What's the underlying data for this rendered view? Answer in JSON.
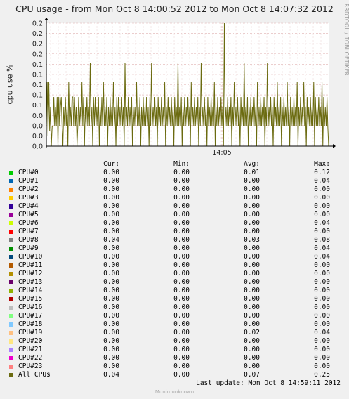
{
  "title": "CPU usage - from Mon Oct  8 14:00:52 2012 to Mon Oct  8 14:07:32 2012",
  "watermark": "RRDTOOL / TOBI OETIKER",
  "footer": "Munin unknown",
  "last_update": "Last update:  Mon Oct  8 14:59:11 2012",
  "colors": {
    "background": "#f0f0f0",
    "plot_bg": "#ffffff",
    "grid": "#e0b0b0",
    "all_cpus": "#6b6b10",
    "axis": "#000000"
  },
  "legend_headers": {
    "cur": "Cur:",
    "min": "Min:",
    "avg": "Avg:",
    "max": "Max:"
  },
  "legend": [
    {
      "name": "CPU#0",
      "color": "#00cc00",
      "cur": "0.00",
      "min": "0.00",
      "avg": "0.01",
      "max": "0.12"
    },
    {
      "name": "CPU#1",
      "color": "#0066b3",
      "cur": "0.00",
      "min": "0.00",
      "avg": "0.00",
      "max": "0.04"
    },
    {
      "name": "CPU#2",
      "color": "#ff8000",
      "cur": "0.00",
      "min": "0.00",
      "avg": "0.00",
      "max": "0.00"
    },
    {
      "name": "CPU#3",
      "color": "#ffcc00",
      "cur": "0.00",
      "min": "0.00",
      "avg": "0.00",
      "max": "0.00"
    },
    {
      "name": "CPU#4",
      "color": "#330099",
      "cur": "0.00",
      "min": "0.00",
      "avg": "0.00",
      "max": "0.00"
    },
    {
      "name": "CPU#5",
      "color": "#990099",
      "cur": "0.00",
      "min": "0.00",
      "avg": "0.00",
      "max": "0.00"
    },
    {
      "name": "CPU#6",
      "color": "#ccff00",
      "cur": "0.00",
      "min": "0.00",
      "avg": "0.00",
      "max": "0.04"
    },
    {
      "name": "CPU#7",
      "color": "#ff0000",
      "cur": "0.00",
      "min": "0.00",
      "avg": "0.00",
      "max": "0.00"
    },
    {
      "name": "CPU#8",
      "color": "#808080",
      "cur": "0.04",
      "min": "0.00",
      "avg": "0.03",
      "max": "0.08"
    },
    {
      "name": "CPU#9",
      "color": "#008f00",
      "cur": "0.00",
      "min": "0.00",
      "avg": "0.00",
      "max": "0.04"
    },
    {
      "name": "CPU#10",
      "color": "#00487d",
      "cur": "0.00",
      "min": "0.00",
      "avg": "0.00",
      "max": "0.04"
    },
    {
      "name": "CPU#11",
      "color": "#b35a00",
      "cur": "0.00",
      "min": "0.00",
      "avg": "0.00",
      "max": "0.00"
    },
    {
      "name": "CPU#12",
      "color": "#b38f00",
      "cur": "0.00",
      "min": "0.00",
      "avg": "0.00",
      "max": "0.00"
    },
    {
      "name": "CPU#13",
      "color": "#6b006b",
      "cur": "0.00",
      "min": "0.00",
      "avg": "0.00",
      "max": "0.00"
    },
    {
      "name": "CPU#14",
      "color": "#8fb300",
      "cur": "0.00",
      "min": "0.00",
      "avg": "0.00",
      "max": "0.00"
    },
    {
      "name": "CPU#15",
      "color": "#b30000",
      "cur": "0.00",
      "min": "0.00",
      "avg": "0.00",
      "max": "0.00"
    },
    {
      "name": "CPU#16",
      "color": "#bebebe",
      "cur": "0.00",
      "min": "0.00",
      "avg": "0.00",
      "max": "0.00"
    },
    {
      "name": "CPU#17",
      "color": "#80ff80",
      "cur": "0.00",
      "min": "0.00",
      "avg": "0.00",
      "max": "0.00"
    },
    {
      "name": "CPU#18",
      "color": "#80c9ff",
      "cur": "0.00",
      "min": "0.00",
      "avg": "0.00",
      "max": "0.00"
    },
    {
      "name": "CPU#19",
      "color": "#ffc080",
      "cur": "0.00",
      "min": "0.00",
      "avg": "0.02",
      "max": "0.04"
    },
    {
      "name": "CPU#20",
      "color": "#ffe680",
      "cur": "0.00",
      "min": "0.00",
      "avg": "0.00",
      "max": "0.00"
    },
    {
      "name": "CPU#21",
      "color": "#aa80ff",
      "cur": "0.00",
      "min": "0.00",
      "avg": "0.00",
      "max": "0.00"
    },
    {
      "name": "CPU#22",
      "color": "#ee00cc",
      "cur": "0.00",
      "min": "0.00",
      "avg": "0.00",
      "max": "0.00"
    },
    {
      "name": "CPU#23",
      "color": "#ff8080",
      "cur": "0.00",
      "min": "0.00",
      "avg": "0.00",
      "max": "0.00"
    },
    {
      "name": "All CPUs",
      "color": "#6b6b10",
      "cur": "0.04",
      "min": "0.00",
      "avg": "0.07",
      "max": "0.25"
    }
  ],
  "chart_data": {
    "type": "line",
    "title": "CPU usage - from Mon Oct  8 14:00:52 2012 to Mon Oct  8 14:07:32 2012",
    "ylabel": "cpu use %",
    "xlabel": "",
    "ylim": [
      0,
      0.25
    ],
    "yticks": [
      0.0,
      0.0,
      0.0,
      0.0,
      0.1,
      0.1,
      0.1,
      0.1,
      0.1,
      0.2,
      0.2,
      0.2,
      0.2
    ],
    "xticks": [
      "14:05"
    ],
    "grid": true,
    "series": [
      {
        "name": "All CPUs",
        "color": "#6b6b10",
        "values": [
          0.04,
          0.13,
          0.02,
          0.13,
          0.03,
          0.08,
          0.0,
          0.04,
          0.04,
          0.1,
          0.04,
          0.08,
          0.04,
          0.1,
          0.0,
          0.1,
          0.04,
          0.08,
          0.1,
          0.04,
          0.0,
          0.08,
          0.04,
          0.1,
          0.04,
          0.08,
          0.0,
          0.13,
          0.04,
          0.08,
          0.04,
          0.1,
          0.1,
          0.04,
          0.1,
          0.04,
          0.08,
          0.0,
          0.04,
          0.1,
          0.04,
          0.08,
          0.04,
          0.13,
          0.04,
          0.1,
          0.0,
          0.08,
          0.04,
          0.1,
          0.04,
          0.08,
          0.04,
          0.17,
          0.04,
          0.08,
          0.0,
          0.1,
          0.04,
          0.1,
          0.04,
          0.08,
          0.04,
          0.1,
          0.0,
          0.08,
          0.04,
          0.1,
          0.04,
          0.13,
          0.04,
          0.08,
          0.04,
          0.1,
          0.0,
          0.08,
          0.04,
          0.1,
          0.04,
          0.08,
          0.04,
          0.13,
          0.04,
          0.08,
          0.0,
          0.1,
          0.04,
          0.1,
          0.04,
          0.08,
          0.04,
          0.1,
          0.04,
          0.08,
          0.0,
          0.17,
          0.04,
          0.08,
          0.04,
          0.1,
          0.04,
          0.08,
          0.04,
          0.1,
          0.0,
          0.08,
          0.04,
          0.08,
          0.04,
          0.13,
          0.04,
          0.08,
          0.04,
          0.1,
          0.0,
          0.08,
          0.04,
          0.1,
          0.04,
          0.08,
          0.04,
          0.1,
          0.04,
          0.08,
          0.0,
          0.1,
          0.04,
          0.17,
          0.04,
          0.08,
          0.04,
          0.1,
          0.04,
          0.08,
          0.0,
          0.1,
          0.04,
          0.08,
          0.04,
          0.1,
          0.04,
          0.08,
          0.04,
          0.13,
          0.0,
          0.08,
          0.04,
          0.1,
          0.04,
          0.08,
          0.04,
          0.1,
          0.04,
          0.08,
          0.0,
          0.1,
          0.04,
          0.08,
          0.04,
          0.17,
          0.04,
          0.08,
          0.04,
          0.1,
          0.0,
          0.08,
          0.04,
          0.1,
          0.04,
          0.08,
          0.04,
          0.1,
          0.04,
          0.08,
          0.0,
          0.13,
          0.04,
          0.08,
          0.04,
          0.1,
          0.04,
          0.08,
          0.04,
          0.1,
          0.0,
          0.08,
          0.04,
          0.17,
          0.04,
          0.08,
          0.04,
          0.1,
          0.04,
          0.08,
          0.0,
          0.1,
          0.04,
          0.08,
          0.04,
          0.1,
          0.04,
          0.08,
          0.04,
          0.13,
          0.0,
          0.08,
          0.04,
          0.1,
          0.04,
          0.08,
          0.04,
          0.1,
          0.04,
          0.08,
          0.0,
          0.25,
          0.04,
          0.08,
          0.04,
          0.1,
          0.04,
          0.08,
          0.04,
          0.1,
          0.0,
          0.08,
          0.04,
          0.13,
          0.04,
          0.08,
          0.04,
          0.1,
          0.04,
          0.08,
          0.0,
          0.1,
          0.04,
          0.08,
          0.04,
          0.17,
          0.04,
          0.08,
          0.04,
          0.1,
          0.0,
          0.08,
          0.04,
          0.1,
          0.04,
          0.08,
          0.04,
          0.1,
          0.04,
          0.08,
          0.0,
          0.13,
          0.04,
          0.08,
          0.04,
          0.1,
          0.04,
          0.08,
          0.04,
          0.1,
          0.0,
          0.08,
          0.04,
          0.17,
          0.04,
          0.08,
          0.04,
          0.1,
          0.04,
          0.08,
          0.0,
          0.1,
          0.04,
          0.08,
          0.04,
          0.13,
          0.04,
          0.08,
          0.04,
          0.1,
          0.0,
          0.08,
          0.04,
          0.1,
          0.04,
          0.08,
          0.04,
          0.13,
          0.04,
          0.08,
          0.0,
          0.1,
          0.04,
          0.08,
          0.04,
          0.1,
          0.04,
          0.08,
          0.04,
          0.13,
          0.0,
          0.08,
          0.04,
          0.1,
          0.04,
          0.08,
          0.04,
          0.13,
          0.04,
          0.08,
          0.0,
          0.1,
          0.04,
          0.08,
          0.04,
          0.1,
          0.04,
          0.08,
          0.04,
          0.13,
          0.0,
          0.1,
          0.04,
          0.08,
          0.04,
          0.1,
          0.04,
          0.08,
          0.04,
          0.13,
          0.0,
          0.1,
          0.04,
          0.08,
          0.04,
          0.1,
          0.04,
          0.0
        ]
      }
    ]
  }
}
